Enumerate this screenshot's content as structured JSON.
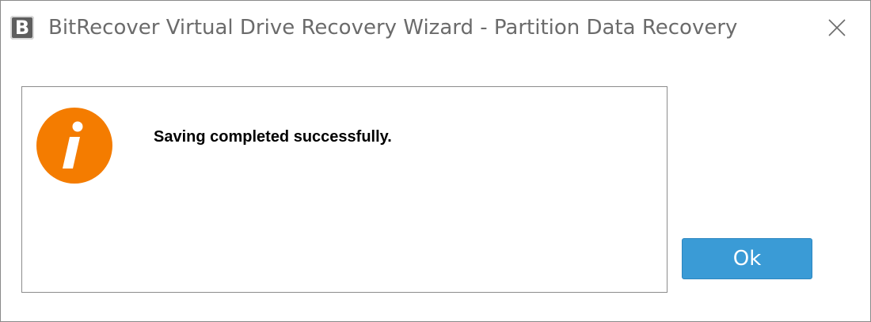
{
  "window": {
    "app_icon_letter": "B",
    "title": "BitRecover Virtual Drive Recovery Wizard - Partition Data Recovery",
    "close_icon": "close-icon"
  },
  "dialog": {
    "icon": "info-icon",
    "icon_color": "#F47C00",
    "message": "Saving completed successfully.",
    "ok_label": "Ok",
    "ok_color": "#3A9BD6"
  }
}
